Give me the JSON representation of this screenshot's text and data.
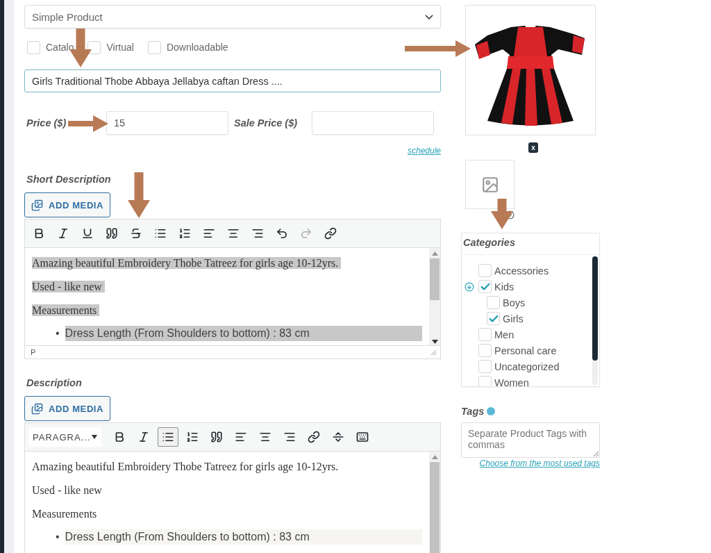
{
  "product_type": {
    "value": "Simple Product"
  },
  "options": [
    {
      "label": "Catalo",
      "checked": false
    },
    {
      "label": "Virtual",
      "checked": false
    },
    {
      "label": "Downloadable",
      "checked": false
    }
  ],
  "title": {
    "value": "Girls Traditional Thobe Abbaya Jellabya caftan Dress ...."
  },
  "price": {
    "label": "Price ($)",
    "value": "15"
  },
  "sale_price": {
    "label": "Sale Price ($)"
  },
  "schedule_link": "schedule",
  "short_description": {
    "label": "Short Description",
    "add_media": "ADD MEDIA",
    "selected_text": true,
    "status": "P",
    "tools": [
      {
        "kind": "bold",
        "active": false,
        "disabled": false
      },
      {
        "kind": "italic",
        "active": false,
        "disabled": false
      },
      {
        "kind": "underline",
        "active": false,
        "disabled": false
      },
      {
        "kind": "quote",
        "active": false,
        "disabled": false
      },
      {
        "kind": "strike",
        "active": false,
        "disabled": false
      },
      {
        "kind": "ul",
        "active": false,
        "disabled": false
      },
      {
        "kind": "ol",
        "active": false,
        "disabled": false
      },
      {
        "kind": "align-left",
        "active": false,
        "disabled": false
      },
      {
        "kind": "align-center",
        "active": false,
        "disabled": false
      },
      {
        "kind": "align-right",
        "active": false,
        "disabled": false
      },
      {
        "kind": "undo",
        "active": false,
        "disabled": false
      },
      {
        "kind": "redo",
        "active": false,
        "disabled": true
      },
      {
        "kind": "link",
        "active": false,
        "disabled": false
      }
    ],
    "paragraphs": [
      "Amazing beautiful Embroidery Thobe Tatreez for girls age 10-12yrs.",
      "Used - like new",
      "Measurements"
    ],
    "bullets": [
      {
        "marker": "•",
        "text": "Dress Length (From Shoulders to bottom) : 83 cm"
      }
    ]
  },
  "description": {
    "label": "Description",
    "add_media": "ADD MEDIA",
    "format": "PARAGRA...",
    "selected_text": false,
    "tools": [
      {
        "kind": "bold",
        "active": false,
        "disabled": false
      },
      {
        "kind": "italic",
        "active": false,
        "disabled": false
      },
      {
        "kind": "ul",
        "active": true,
        "disabled": false
      },
      {
        "kind": "ol",
        "active": false,
        "disabled": false
      },
      {
        "kind": "quote",
        "active": false,
        "disabled": false
      },
      {
        "kind": "align-left",
        "active": false,
        "disabled": false
      },
      {
        "kind": "align-center",
        "active": false,
        "disabled": false
      },
      {
        "kind": "align-right",
        "active": false,
        "disabled": false
      },
      {
        "kind": "link",
        "active": false,
        "disabled": false
      },
      {
        "kind": "more",
        "active": false,
        "disabled": false
      },
      {
        "kind": "keyboard",
        "active": false,
        "disabled": false
      }
    ],
    "paragraphs": [
      "Amazing beautiful Embroidery Thobe Tatreez for girls age 10-12yrs.",
      "Used - like new",
      "Measurements"
    ],
    "bullets": [
      {
        "marker": "•",
        "text": "Dress Length (From Shoulders to bottom) : 83 cm"
      }
    ]
  },
  "image": {
    "remove": "x"
  },
  "categories": {
    "title": "Categories",
    "items": [
      {
        "label": "Accessories",
        "checked": false
      },
      {
        "label": "Kids",
        "checked": true,
        "children": [
          {
            "label": "Boys",
            "checked": false
          },
          {
            "label": "Girls",
            "checked": true
          }
        ]
      },
      {
        "label": "Men",
        "checked": false
      },
      {
        "label": "Personal care",
        "checked": false
      },
      {
        "label": "Uncategorized",
        "checked": false
      },
      {
        "label": "Women",
        "checked": false
      }
    ]
  },
  "tags": {
    "label": "Tags",
    "placeholder": "Separate Product Tags with commas",
    "link": "Choose from the most used tags"
  }
}
